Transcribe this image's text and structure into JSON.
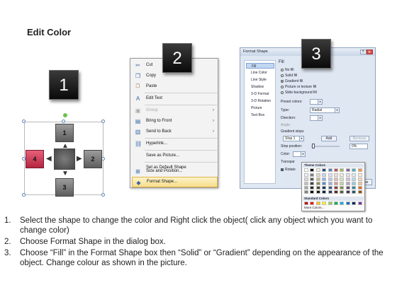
{
  "title": "Edit Color",
  "badges": [
    "1",
    "2",
    "3"
  ],
  "diagram": {
    "shapes": [
      "1",
      "2",
      "3",
      "4"
    ]
  },
  "context_menu": {
    "items": [
      {
        "label": "Cut",
        "icon": "scissors-icon",
        "glyph": "✂",
        "disabled": false
      },
      {
        "label": "Copy",
        "icon": "copy-icon",
        "glyph": "❐",
        "disabled": false
      },
      {
        "label": "Paste",
        "icon": "paste-icon",
        "glyph": "📋",
        "disabled": false
      },
      {
        "label": "Edit Text",
        "icon": "edit-text-icon",
        "glyph": "A",
        "disabled": false
      },
      {
        "label": "Group",
        "icon": "group-icon",
        "glyph": "▣",
        "disabled": true,
        "submenu": true
      },
      {
        "label": "Bring to Front",
        "icon": "bring-front-icon",
        "glyph": "▤",
        "disabled": false,
        "submenu": true
      },
      {
        "label": "Send to Back",
        "icon": "send-back-icon",
        "glyph": "▥",
        "disabled": false,
        "submenu": true
      },
      {
        "label": "Hyperlink...",
        "icon": "hyperlink-icon",
        "glyph": "⛓",
        "disabled": false
      },
      {
        "label": "Save as Picture...",
        "icon": "",
        "glyph": "",
        "disabled": false
      },
      {
        "label": "Set as Default Shape",
        "icon": "",
        "glyph": "",
        "disabled": false
      },
      {
        "label": "Size and Position...",
        "icon": "size-position-icon",
        "glyph": "⊞",
        "disabled": false
      },
      {
        "label": "Format Shape...",
        "icon": "format-shape-icon",
        "glyph": "◆",
        "disabled": false,
        "hover": true
      }
    ]
  },
  "format_dialog": {
    "title": "Format Shape",
    "nav": [
      "Fill",
      "Line Color",
      "Line Style",
      "Shadow",
      "3-D Format",
      "3-D Rotation",
      "Picture",
      "Text Box"
    ],
    "section": "Fill",
    "fill_options": [
      {
        "label": "No fill",
        "checked": false
      },
      {
        "label": "Solid fill",
        "checked": false
      },
      {
        "label": "Gradient fill",
        "checked": true
      },
      {
        "label": "Picture or texture fill",
        "checked": false
      },
      {
        "label": "Slide background fill",
        "checked": false
      }
    ],
    "preset_colors_label": "Preset colors:",
    "type_label": "Type:",
    "type_value": "Radial",
    "direction_label": "Direction:",
    "angle_label": "Angle:",
    "gradient_stops_label": "Gradient stops",
    "stop_value": "Stop 1",
    "add_label": "Add",
    "remove_label": "Remove",
    "stop_position_label": "Stop position:",
    "stop_position_value": "0%",
    "color_label": "Color:",
    "transparency_label": "Transpar",
    "rotate_label": "Rotate",
    "close_label": "Close"
  },
  "palette": {
    "theme_label": "Theme Colors",
    "standard_label": "Standard Colors",
    "more_label": "More Colors...",
    "theme_top": [
      "#ffffff",
      "#000000",
      "#eeece1",
      "#1f497d",
      "#4f81bd",
      "#c0504d",
      "#9bbb59",
      "#8064a2",
      "#4bacc6",
      "#f79646"
    ],
    "theme_columns": [
      [
        "#f2f2f2",
        "#d9d9d9",
        "#bfbfbf",
        "#a6a6a6",
        "#808080"
      ],
      [
        "#7f7f7f",
        "#595959",
        "#404040",
        "#262626",
        "#0d0d0d"
      ],
      [
        "#ddd9c3",
        "#c4bd97",
        "#938953",
        "#4a452a",
        "#1e1c11"
      ],
      [
        "#c6d9f0",
        "#8db3e2",
        "#548dd4",
        "#17365d",
        "#0f243e"
      ],
      [
        "#dbe5f1",
        "#b8cce4",
        "#95b3d7",
        "#366092",
        "#244061"
      ],
      [
        "#f2dcdb",
        "#e5b9b7",
        "#d99694",
        "#953734",
        "#632423"
      ],
      [
        "#ebf1dd",
        "#d7e3bc",
        "#c3d69b",
        "#76923c",
        "#4f6128"
      ],
      [
        "#e5e0ec",
        "#ccc1d9",
        "#b2a2c7",
        "#5f497a",
        "#3f3151"
      ],
      [
        "#dbeef3",
        "#b7dde8",
        "#92cddc",
        "#31859b",
        "#205867"
      ],
      [
        "#fdeada",
        "#fbd5b5",
        "#fac08f",
        "#e36c09",
        "#974806"
      ]
    ],
    "standard": [
      "#c00000",
      "#ff0000",
      "#ffc000",
      "#ffff00",
      "#92d050",
      "#00b050",
      "#00b0f0",
      "#0070c0",
      "#002060",
      "#7030a0"
    ]
  },
  "steps": [
    {
      "num": "1.",
      "text": "Select the shape to change the color and Right click the object( click any object which you want to change color)"
    },
    {
      "num": "2.",
      "text": "Choose Format Shape in the dialog box."
    },
    {
      "num": "3.",
      "text": "Choose “Fill” in the Format Shape box then “Solid” or “Gradient” depending on the appearance of the object. Change colour as shown in the picture."
    }
  ]
}
